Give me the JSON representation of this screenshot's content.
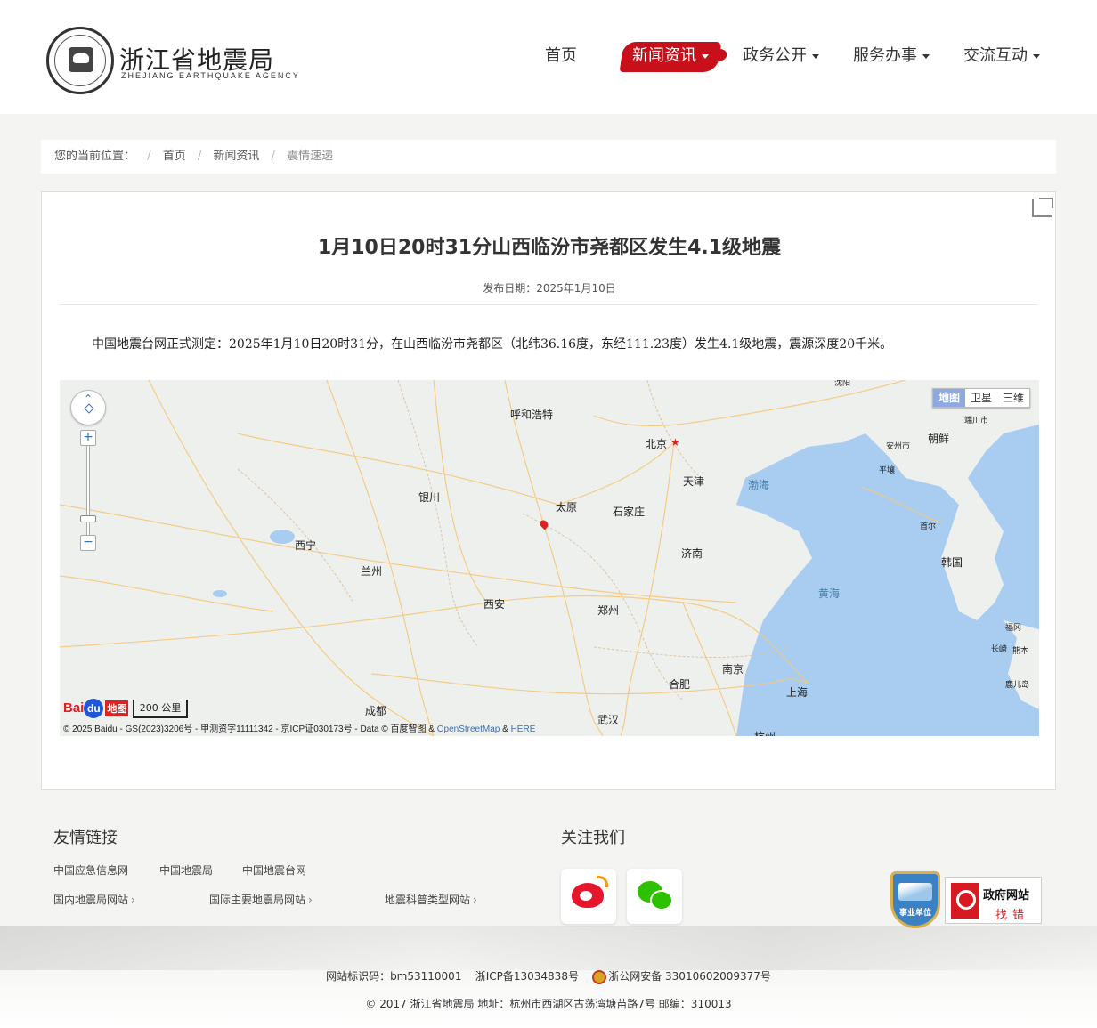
{
  "header": {
    "logo_cn": "浙江省地震局",
    "logo_en": "ZHEJIANG  EARTHQUAKE  AGENCY",
    "nav": [
      {
        "label": "首页"
      },
      {
        "label": "新闻资讯"
      },
      {
        "label": "政务公开"
      },
      {
        "label": "服务办事"
      },
      {
        "label": "交流互动"
      }
    ],
    "accent_color": "#c8101b"
  },
  "breadcrumb": {
    "prefix": "您的当前位置：",
    "items": [
      "首页",
      "新闻资讯",
      "震情速递"
    ],
    "separator": "/"
  },
  "article": {
    "title": "1月10日20时31分山西临汾市尧都区发生4.1级地震",
    "date": "发布日期：2025年1月10日",
    "body": "中国地震台网正式测定：2025年1月10日20时31分，在山西临汾市尧都区（北纬36.16度，东经111.23度）发生4.1级地震，震源深度20千米。"
  },
  "map": {
    "types": [
      "地图",
      "卫星",
      "三维"
    ],
    "active_type": "地图",
    "zoom_in": "+",
    "zoom_out": "−",
    "scale": "200 公里",
    "baidu_prefix": "Bai",
    "baidu_du": "du",
    "baidu_suffix": "地图",
    "copyright": "© 2025 Baidu - GS(2023)3206号 - 甲测资字11111342 - 京ICP证030173号 - Data © 百度智图 & ",
    "copyright_link1": "OpenStreetMap",
    "copyright_amp": " & ",
    "copyright_link2": "HERE",
    "labels": {
      "huhehaote": "呼和浩特",
      "beijing": "北京",
      "tianjin": "天津",
      "bohai": "渤海",
      "yinchuan": "银川",
      "taiyuan": "太原",
      "shijiazhuang": "石家庄",
      "xining": "西宁",
      "lanzhou": "兰州",
      "jinan": "济南",
      "xian": "西安",
      "zhengzhou": "郑州",
      "huanghai": "黄海",
      "nanjing": "南京",
      "hefei": "合肥",
      "shanghai": "上海",
      "chengdu": "成都",
      "wuhan": "武汉",
      "hangzhou": "杭州",
      "chaoxian": "朝鲜",
      "hanguo": "韩国",
      "pingrang": "平壤",
      "shouer": "首尔",
      "anzhou": "安州市",
      "duanchuan": "端川市",
      "fugang": "福冈",
      "changqi": "长崎",
      "xionben": "熊本",
      "luerdao": "鹿儿岛",
      "shenyang": "沈阳"
    }
  },
  "footer": {
    "links_title": "友情链接",
    "follow_title": "关注我们",
    "links_row1": [
      "中国应急信息网",
      "中国地震局",
      "中国地震台网"
    ],
    "links_row2": [
      "国内地震局网站",
      "国际主要地震局网站",
      "地震科普类型网站"
    ],
    "link_arrow": "›",
    "badge1": "事业单位",
    "badge2_line1": "政府网站",
    "badge2_line2": "找错",
    "site_code": "网站标识码：bm53110001",
    "icp": "浙ICP备13034838号",
    "police": "浙公网安备 33010602009377号",
    "copyright": "© 2017 浙江省地震局 地址：杭州市西湖区古荡湾塘苗路7号 邮编：310013"
  }
}
